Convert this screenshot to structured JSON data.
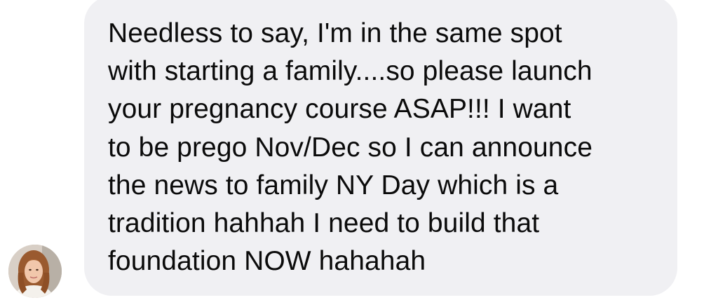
{
  "conversation": {
    "received_message": {
      "lines": [
        "Needless to say, I'm in the same spot",
        "with starting a family....so please launch",
        "your pregnancy course ASAP!!! I want",
        "to be prego Nov/Dec so I can announce",
        "the news to family NY Day which is a",
        "tradition hahhah I need to build that",
        "foundation NOW hahahah"
      ]
    },
    "sender": {
      "avatar_icon": "profile-photo-avatar"
    }
  },
  "colors": {
    "bubble_background": "#f0f0f3",
    "text": "#0b0b0b",
    "page_background": "#ffffff"
  }
}
